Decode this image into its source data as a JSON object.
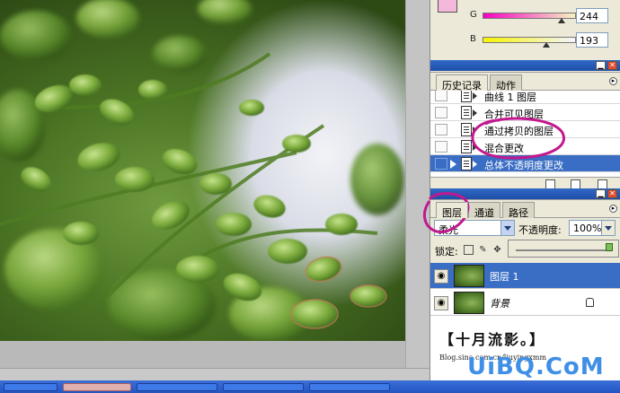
{
  "color_panel": {
    "g_label": "G",
    "g_value": "244",
    "b_label": "B",
    "b_value": "193",
    "swatch_color": "#f3b8dc"
  },
  "history_panel": {
    "tabs": [
      "历史记录",
      "动作"
    ],
    "items": [
      {
        "label": "曲线 1 图层",
        "selected": false
      },
      {
        "label": "合并可见图层",
        "selected": false
      },
      {
        "label": "通过拷贝的图层",
        "selected": false
      },
      {
        "label": "混合更改",
        "selected": false
      },
      {
        "label": "总体不透明度更改",
        "selected": true
      }
    ]
  },
  "layers_panel": {
    "tabs": [
      "图层",
      "通道",
      "路径"
    ],
    "blend_mode": "柔光",
    "opacity_label": "不透明度:",
    "opacity_value": "100%",
    "lock_label": "锁定:",
    "layers": [
      {
        "name": "图层 1",
        "selected": true
      },
      {
        "name": "背景",
        "selected": false
      }
    ]
  },
  "branding": {
    "title": "【十月流影。】",
    "url": "Blog.sina.com.cn/liuyingxmm",
    "watermark": "UiBQ.CoM"
  },
  "colors": {
    "selection": "#3a6ec5",
    "annotation": "#c2188f",
    "palette_bar": "#2a5bb6"
  }
}
